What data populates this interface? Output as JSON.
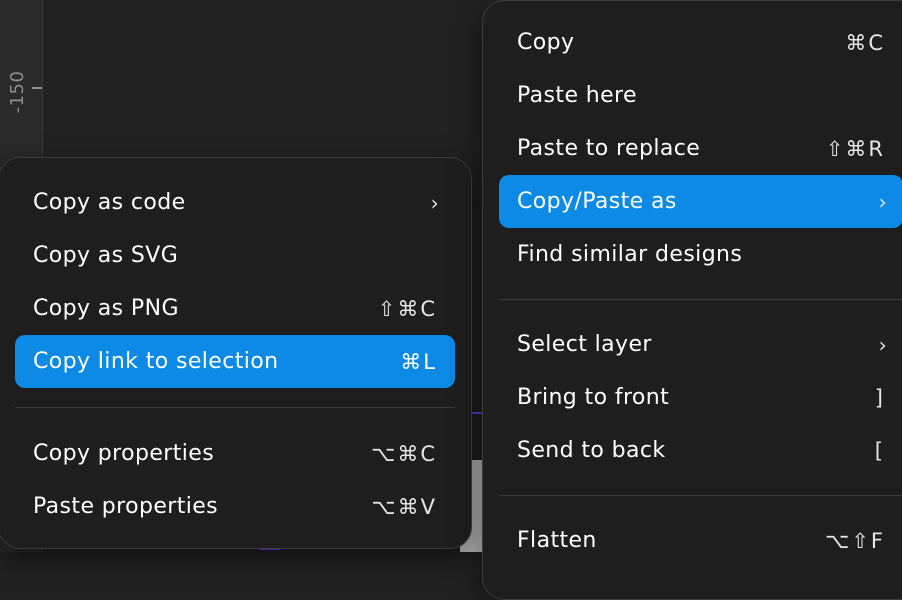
{
  "ruler": {
    "label": "-150"
  },
  "left_menu": {
    "items": [
      {
        "label": "Copy as code",
        "shortcut": "",
        "submenu": true
      },
      {
        "label": "Copy as SVG",
        "shortcut": ""
      },
      {
        "label": "Copy as PNG",
        "shortcut": "⇧⌘C"
      },
      {
        "label": "Copy link to selection",
        "shortcut": "⌘L",
        "active": true
      },
      {
        "label": "Copy properties",
        "shortcut": "⌥⌘C"
      },
      {
        "label": "Paste properties",
        "shortcut": "⌥⌘V"
      }
    ]
  },
  "right_menu": {
    "items": [
      {
        "label": "Copy",
        "shortcut": "⌘C"
      },
      {
        "label": "Paste here",
        "shortcut": ""
      },
      {
        "label": "Paste to replace",
        "shortcut": "⇧⌘R"
      },
      {
        "label": "Copy/Paste as",
        "shortcut": "",
        "submenu": true,
        "active": true
      },
      {
        "label": "Find similar designs",
        "shortcut": ""
      },
      {
        "label": "Select layer",
        "shortcut": "",
        "submenu": true
      },
      {
        "label": "Bring to front",
        "shortcut": "]"
      },
      {
        "label": "Send to back",
        "shortcut": "["
      },
      {
        "label": "Flatten",
        "shortcut": "⌥⇧F"
      }
    ]
  },
  "icons": {
    "submenu": "chevron-right-icon"
  },
  "colors": {
    "active": "#0d8ae6",
    "menu_bg": "#1e1e1e",
    "canvas_bg": "#222222",
    "selection": "#7a3cff"
  }
}
